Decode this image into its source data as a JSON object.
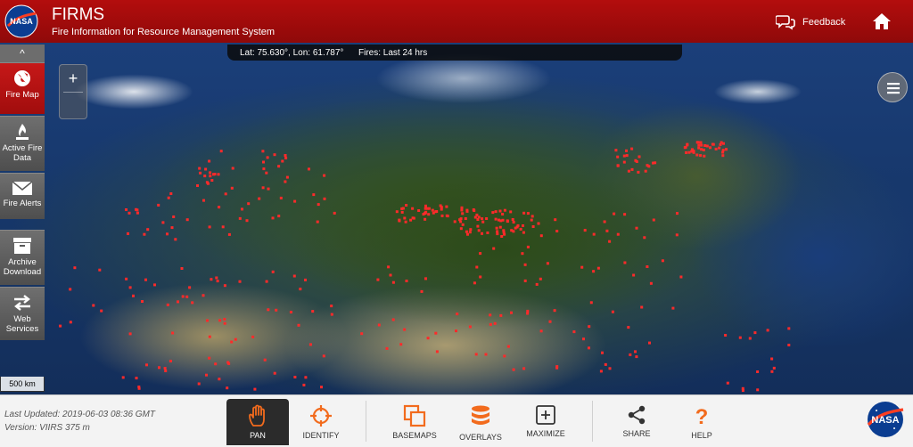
{
  "header": {
    "title": "FIRMS",
    "subtitle": "Fire Information for Resource Management System",
    "logo_text": "NASA",
    "feedback_label": "Feedback"
  },
  "map": {
    "coordinates": "Lat: 75.630°, Lon: 61.787°",
    "fires": "Fires: Last 24 hrs",
    "scale": "500 km",
    "zoom_in_label": "+",
    "collapse_label": "^",
    "fire_color": "#ff2a2a"
  },
  "sidebar": {
    "items": [
      {
        "label": "Fire Map",
        "icon": "globe-icon"
      },
      {
        "label": "Active Fire Data",
        "icon": "flame-icon"
      },
      {
        "label": "Fire Alerts",
        "icon": "envelope-icon"
      },
      {
        "label": "Archive Download",
        "icon": "archive-box-icon"
      },
      {
        "label": "Web Services",
        "icon": "swap-arrows-icon"
      }
    ]
  },
  "footer": {
    "last_updated": "Last Updated: 2019-06-03 08:36 GMT",
    "version": "Version: VIIRS 375 m",
    "tools": [
      {
        "label": "PAN",
        "icon": "hand-icon"
      },
      {
        "label": "IDENTIFY",
        "icon": "crosshair-icon"
      },
      {
        "label": "BASEMAPS",
        "icon": "basemaps-icon"
      },
      {
        "label": "OVERLAYS",
        "icon": "layers-stack-icon"
      },
      {
        "label": "MAXIMIZE",
        "icon": "plus-square-icon"
      },
      {
        "label": "SHARE",
        "icon": "share-icon"
      },
      {
        "label": "HELP",
        "icon": "question-icon"
      }
    ]
  },
  "colors": {
    "header_red": "#a80c0c",
    "accent_orange": "#f26b1d",
    "active_tool": "#2b2b2b"
  }
}
